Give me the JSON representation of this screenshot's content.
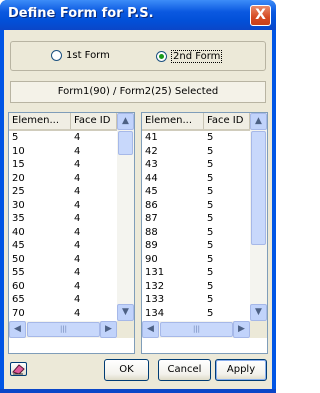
{
  "window": {
    "title": "Define Form for P.S.",
    "close_label": "X"
  },
  "form_choice": {
    "options": [
      {
        "label": "1st Form",
        "selected": false
      },
      {
        "label": "2nd Form",
        "selected": true
      }
    ]
  },
  "status": "Form1(90) / Form2(25) Selected",
  "left_list": {
    "headers": [
      "Elemen...",
      "Face ID"
    ],
    "rows": [
      [
        "5",
        "4"
      ],
      [
        "10",
        "4"
      ],
      [
        "15",
        "4"
      ],
      [
        "20",
        "4"
      ],
      [
        "25",
        "4"
      ],
      [
        "30",
        "4"
      ],
      [
        "35",
        "4"
      ],
      [
        "40",
        "4"
      ],
      [
        "45",
        "4"
      ],
      [
        "50",
        "4"
      ],
      [
        "55",
        "4"
      ],
      [
        "60",
        "4"
      ],
      [
        "65",
        "4"
      ],
      [
        "70",
        "4"
      ]
    ]
  },
  "right_list": {
    "headers": [
      "Elemen...",
      "Face ID"
    ],
    "rows": [
      [
        "41",
        "5"
      ],
      [
        "42",
        "5"
      ],
      [
        "43",
        "5"
      ],
      [
        "44",
        "5"
      ],
      [
        "45",
        "5"
      ],
      [
        "86",
        "5"
      ],
      [
        "87",
        "5"
      ],
      [
        "88",
        "5"
      ],
      [
        "89",
        "5"
      ],
      [
        "90",
        "5"
      ],
      [
        "131",
        "5"
      ],
      [
        "132",
        "5"
      ],
      [
        "133",
        "5"
      ],
      [
        "134",
        "5"
      ]
    ]
  },
  "buttons": {
    "ok": "OK",
    "cancel": "Cancel",
    "apply": "Apply"
  },
  "icons": {
    "eraser": "eraser-icon"
  }
}
